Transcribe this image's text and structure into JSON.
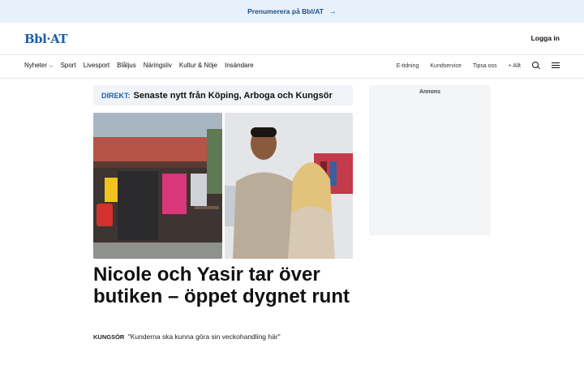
{
  "promo": {
    "text": "Prenumerera på Bbl/AT"
  },
  "masthead": {
    "logo": "Bbl·AT",
    "login": "Logga in"
  },
  "nav": {
    "items": [
      "Nyheter",
      "Sport",
      "Livesport",
      "Blåljus",
      "Näringsliv",
      "Kultur & Nöje",
      "Insändare"
    ],
    "right_items": [
      "E-tidning",
      "Kundservice",
      "Tipsa oss",
      "+ Allt"
    ]
  },
  "direkt": {
    "tag": "DIREKT:",
    "text": "Senaste nytt från Köping, Arboga och Kungsör"
  },
  "article": {
    "headline": "Nicole och Yasir tar över butiken – öppet dygnet runt",
    "place": "KUNGSÖR",
    "kicker": "\"Kunderna ska kunna göra sin veckohandling här\""
  },
  "ad": {
    "label": "Annons"
  }
}
